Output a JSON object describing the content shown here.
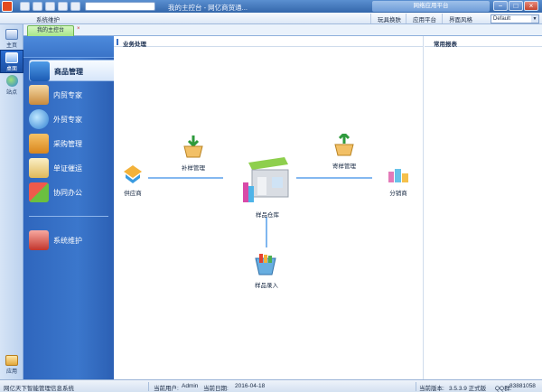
{
  "titlebar": {
    "search_placeholder": "",
    "title": "我的主控台 - 网亿商贸通...",
    "pill": "网络应用平台",
    "minimize": "−",
    "maximize": "□",
    "close": "×"
  },
  "menubar": {
    "system": "系统维护",
    "skin": "玩具换肤",
    "app_platform": "应用平台",
    "theme": "界面风格",
    "theme_value": "Default"
  },
  "tab": {
    "label": "我的主控台"
  },
  "leftbar": {
    "home": "主页",
    "desktop": "桌面",
    "site": "站点",
    "app": "应用"
  },
  "nav": {
    "items": [
      {
        "label": "商品管理",
        "icon": "product-icon"
      },
      {
        "label": "内贸专家",
        "icon": "domestic-trade-icon"
      },
      {
        "label": "外贸专家",
        "icon": "foreign-trade-icon"
      },
      {
        "label": "采购管理",
        "icon": "purchase-icon"
      },
      {
        "label": "单证催运",
        "icon": "document-icon"
      },
      {
        "label": "协同办公",
        "icon": "collaboration-icon"
      }
    ],
    "system_item": {
      "label": "系统维护",
      "icon": "system-maintenance-icon"
    }
  },
  "content": {
    "business_head": "业务处理",
    "reports_head": "常用报表",
    "nodes": {
      "supplier": "供应商",
      "purchase_sample": "补样管理",
      "warehouse": "样品仓库",
      "send_sample": "寄样管理",
      "distributor": "分销商",
      "sample_entry": "样品录入"
    }
  },
  "statusbar": {
    "app_name": "网亿天下智能管理信息系统",
    "user_label": "当前用户:",
    "user": "Admin",
    "date_label": "当前日期:",
    "date": "2016-04-18",
    "version_label": "当前版本:",
    "version": "3.5.3.9 正式版",
    "qq_label": "QQ群:",
    "qq": "83881058"
  },
  "colors": {
    "nav_blue": "#3b77cc",
    "flow_line": "#3a8ee6",
    "tab_green": "#a7e58a"
  }
}
